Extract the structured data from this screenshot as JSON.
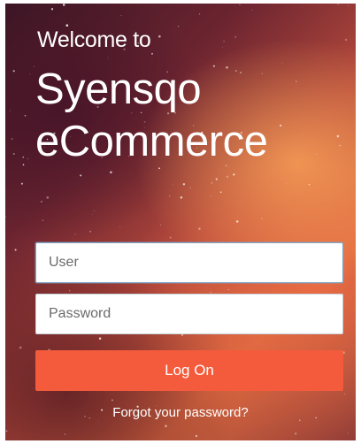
{
  "header": {
    "welcome_text": "Welcome to",
    "brand_line_1": "Syensqo",
    "brand_line_2": "eCommerce"
  },
  "login": {
    "user_placeholder": "User",
    "user_value": "",
    "password_placeholder": "Password",
    "password_value": "",
    "logon_label": "Log On",
    "forgot_label": "Forgot your password?"
  },
  "colors": {
    "primary_button": "#f45b3c",
    "text_on_background": "#ffffff"
  }
}
